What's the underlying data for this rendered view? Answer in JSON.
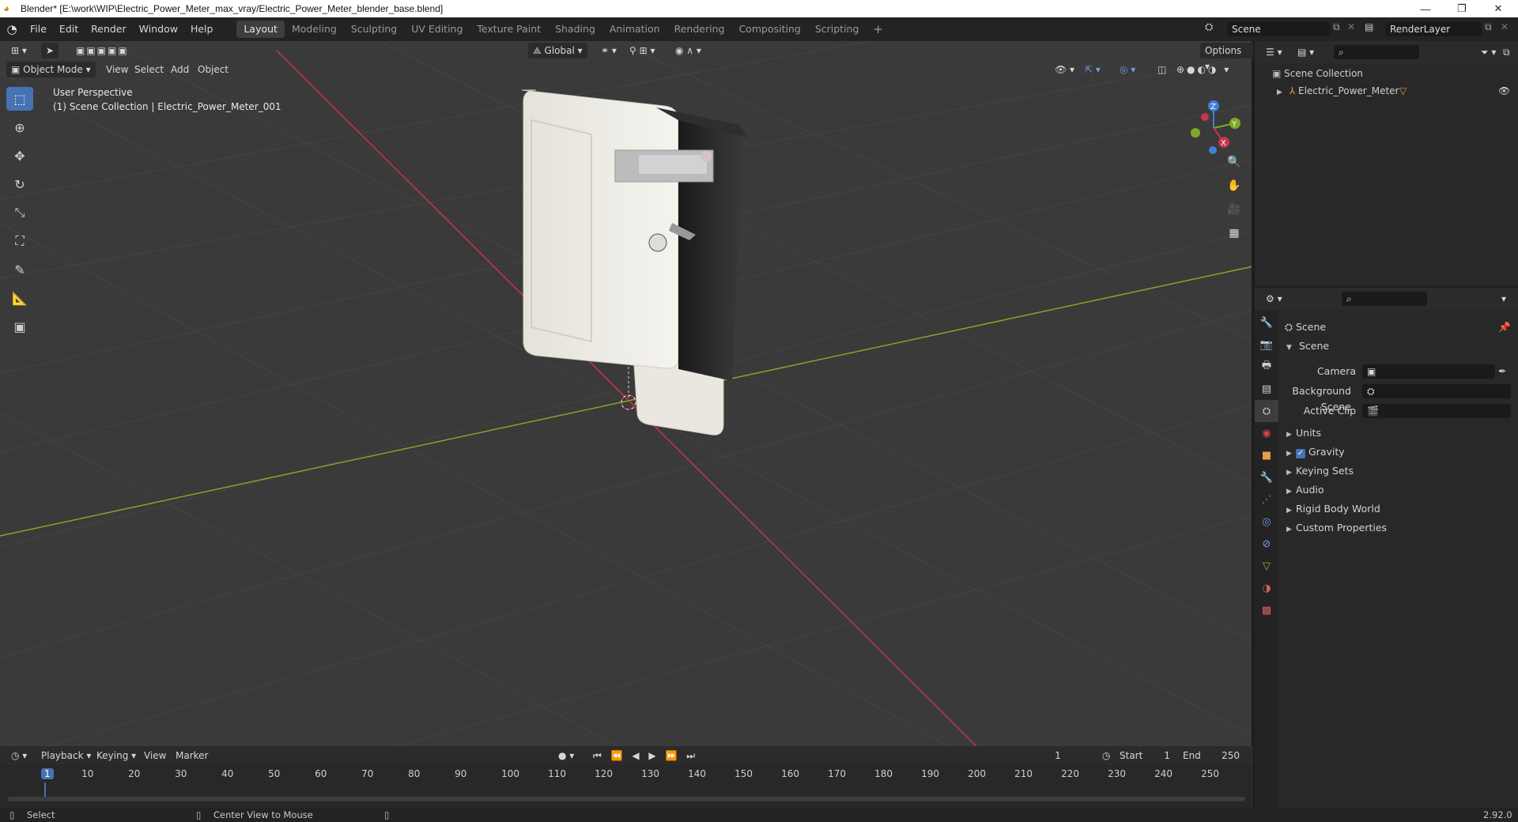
{
  "window": {
    "title": "Blender* [E:\\work\\WIP\\Electric_Power_Meter_max_vray/Electric_Power_Meter_blender_base.blend]",
    "minimize": "—",
    "restore": "❐",
    "close": "✕"
  },
  "menu": [
    "File",
    "Edit",
    "Render",
    "Window",
    "Help"
  ],
  "workspaces": [
    "Layout",
    "Modeling",
    "Sculpting",
    "UV Editing",
    "Texture Paint",
    "Shading",
    "Animation",
    "Rendering",
    "Compositing",
    "Scripting"
  ],
  "active_workspace": "Layout",
  "scene_field": "Scene",
  "renderlayer_field": "RenderLayer",
  "viewport": {
    "mode": "Object Mode",
    "menus": [
      "View",
      "Select",
      "Add",
      "Object"
    ],
    "orientation": "Global",
    "options": "Options",
    "overlay_line1": "User Perspective",
    "overlay_line2": "(1) Scene Collection | Electric_Power_Meter_001",
    "gizmo": {
      "x": "X",
      "y": "Y",
      "z": "Z"
    }
  },
  "outliner": {
    "root": "Scene Collection",
    "items": [
      {
        "name": "Electric_Power_Meter"
      }
    ]
  },
  "properties": {
    "header": "Scene",
    "section": "Scene",
    "fields": [
      {
        "label": "Camera",
        "value": ""
      },
      {
        "label": "Background Scene",
        "value": ""
      },
      {
        "label": "Active Clip",
        "value": ""
      }
    ],
    "panels": [
      {
        "label": "Units",
        "checkbox": false
      },
      {
        "label": "Gravity",
        "checkbox": true
      },
      {
        "label": "Keying Sets",
        "checkbox": false
      },
      {
        "label": "Audio",
        "checkbox": false
      },
      {
        "label": "Rigid Body World",
        "checkbox": false
      },
      {
        "label": "Custom Properties",
        "checkbox": false
      }
    ]
  },
  "timeline": {
    "menus": [
      "Playback",
      "Keying",
      "View",
      "Marker"
    ],
    "current_frame": "1",
    "start_label": "Start",
    "start": "1",
    "end_label": "End",
    "end": "250",
    "ruler": [
      "1",
      "10",
      "20",
      "30",
      "40",
      "50",
      "60",
      "70",
      "80",
      "90",
      "100",
      "110",
      "120",
      "130",
      "140",
      "150",
      "160",
      "170",
      "180",
      "190",
      "200",
      "210",
      "220",
      "230",
      "240",
      "250"
    ]
  },
  "status": {
    "select": "Select",
    "center": "Center View to Mouse",
    "version": "2.92.0"
  },
  "colors": {
    "accent": "#4772b3",
    "x_axis": "#c8344b",
    "y_axis": "#7fa827",
    "z_axis": "#3f7fd6"
  }
}
